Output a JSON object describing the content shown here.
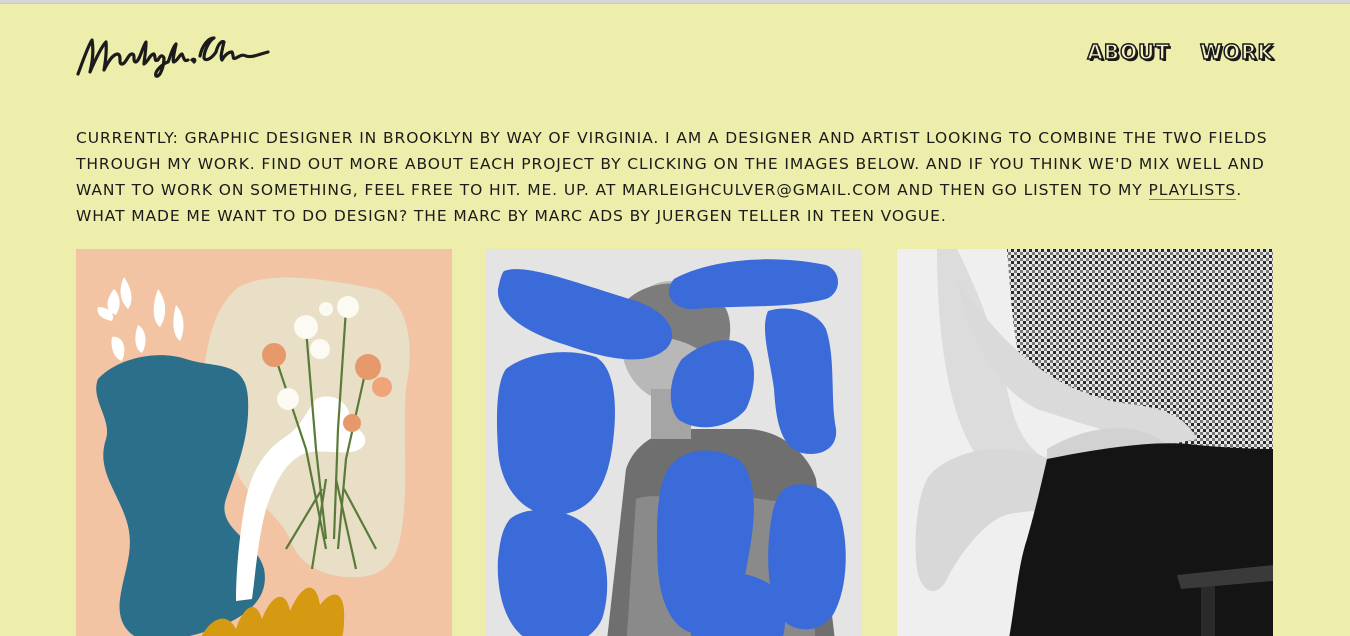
{
  "site": {
    "logo_text": "Marleigh Culver"
  },
  "nav": {
    "items": [
      {
        "label": "ABOUT"
      },
      {
        "label": "WORK"
      }
    ]
  },
  "intro": {
    "part1": "Currently: Graphic designer in Brooklyn by way of Virginia. I am a designer and artist looking to combine the two fields through my work. Find out more about each project by clicking on the images below. And if you think we'd mix well and want to work on something, feel free to hit. me. up. at marleighculver@gmail.com and then go listen to my ",
    "link_label": "playlists",
    "part2": ". What made me want to do design? The Marc by Marc ads by Juergen Teller in Teen Vogue."
  },
  "colors": {
    "background": "#eeeeac",
    "peach": "#f2c4a3",
    "teal": "#2c6f8a",
    "mustard": "#d59a12",
    "blue_blob": "#3a6bd8"
  },
  "projects": [
    {
      "image": "floral-collage-illustration"
    },
    {
      "image": "portrait-with-blue-blobs"
    },
    {
      "image": "checkered-shirt-photo"
    }
  ]
}
